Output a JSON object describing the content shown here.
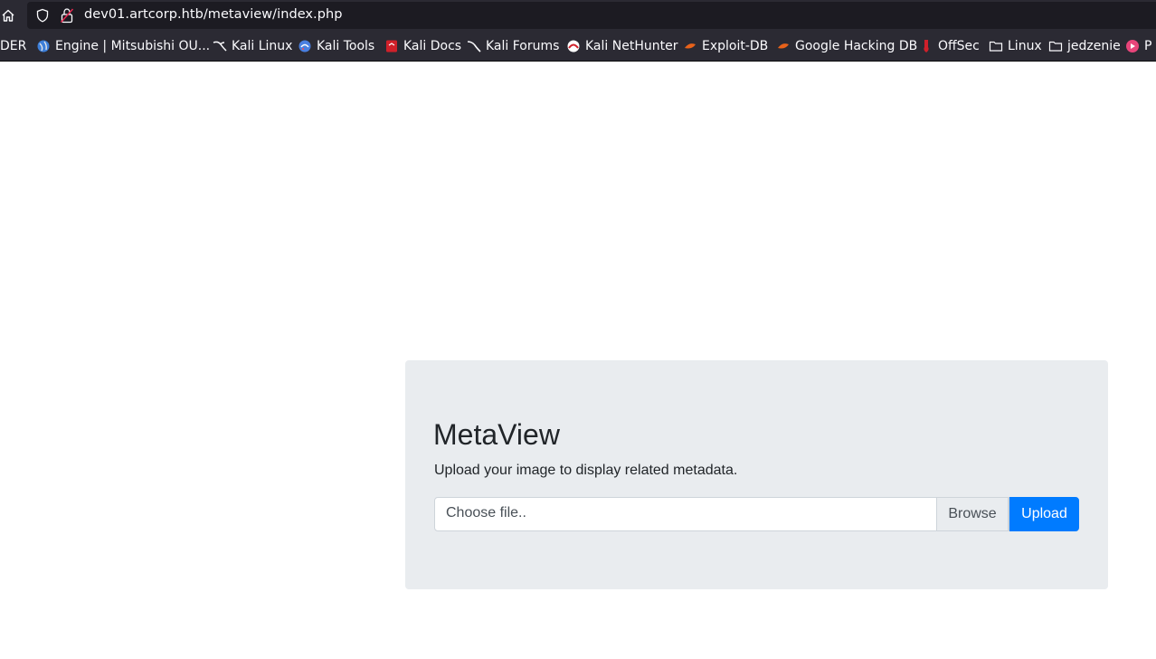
{
  "browser": {
    "url": "dev01.artcorp.htb/metaview/index.php",
    "bookmarks": [
      {
        "label": "DER",
        "icon": "none"
      },
      {
        "label": "Engine | Mitsubishi OU...",
        "icon": "globe-icon"
      },
      {
        "label": "Kali Linux",
        "icon": "kali-dragon-icon"
      },
      {
        "label": "Kali Tools",
        "icon": "kali-tools-icon"
      },
      {
        "label": "Kali Docs",
        "icon": "kali-docs-icon"
      },
      {
        "label": "Kali Forums",
        "icon": "kali-dragon-icon"
      },
      {
        "label": "Kali NetHunter",
        "icon": "nethunter-icon"
      },
      {
        "label": "Exploit-DB",
        "icon": "exploit-db-icon"
      },
      {
        "label": "Google Hacking DB",
        "icon": "ghdb-icon"
      },
      {
        "label": "OffSec",
        "icon": "offsec-icon"
      },
      {
        "label": "Linux",
        "icon": "folder-icon"
      },
      {
        "label": "jedzenie",
        "icon": "folder-icon"
      },
      {
        "label": "P",
        "icon": "pocket-icon"
      }
    ]
  },
  "page": {
    "title": "MetaView",
    "lead": "Upload your image to display related metadata.",
    "file_placeholder": "Choose file..",
    "browse_label": "Browse",
    "upload_label": "Upload"
  },
  "colors": {
    "chrome_bg": "#2b2a33",
    "url_field_bg": "#1c1b22",
    "jumbotron_bg": "#e9ecef",
    "primary": "#007bff"
  }
}
